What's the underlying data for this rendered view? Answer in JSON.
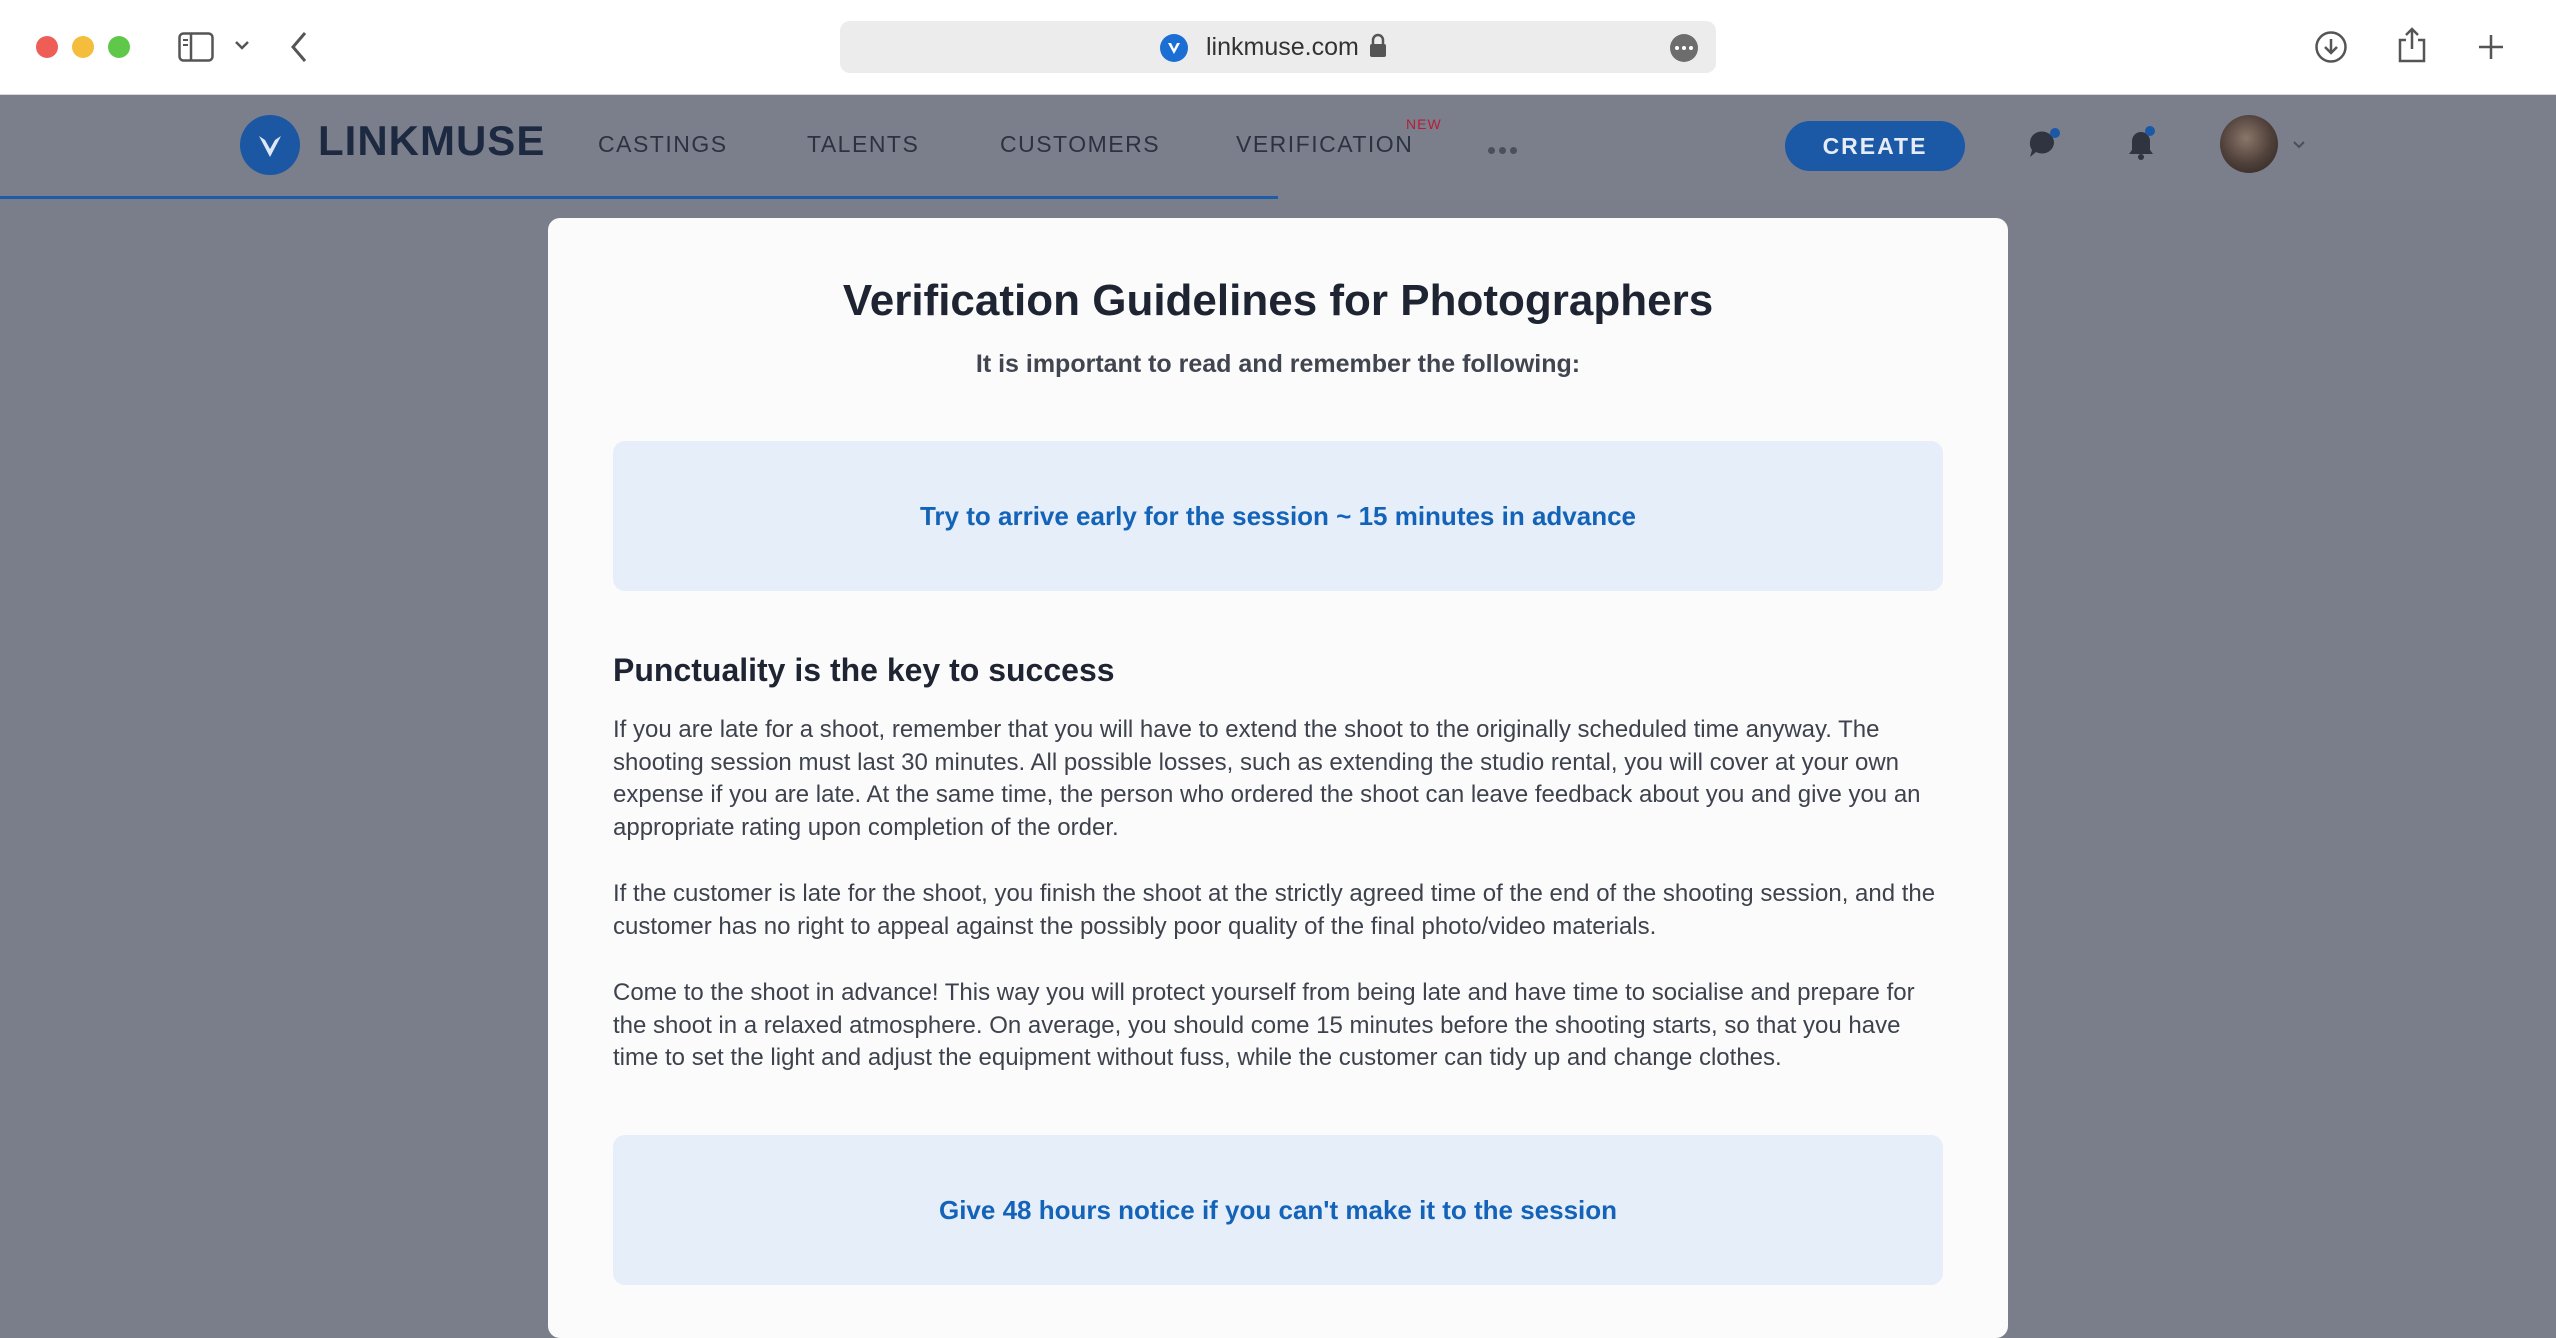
{
  "browser": {
    "url": "linkmuse.com"
  },
  "app": {
    "brand": "LINKMUSE",
    "nav": [
      {
        "label": "CASTINGS"
      },
      {
        "label": "TALENTS"
      },
      {
        "label": "CUSTOMERS"
      },
      {
        "label": "VERIFICATION",
        "badge": "NEW"
      }
    ],
    "create_label": "CREATE",
    "accent_color": "#1b58a6",
    "badge_color": "#b51d3a"
  },
  "content": {
    "title": "Verification Guidelines for Photographers",
    "subtitle": "It is important to read and remember the following:",
    "callouts": [
      "Try to arrive early for the session ~ 15 minutes in advance",
      "Give 48 hours notice if you can't make it to the session"
    ],
    "section_heading": "Punctuality is the key to success",
    "paragraphs": [
      "If you are late for a shoot, remember that you will have to extend the shoot to the originally scheduled time anyway. The shooting session must last 30 minutes. All possible losses, such as extending the studio rental, you will cover at your own expense if you are late. At the same time, the person who ordered the shoot can leave feedback about you and give you an appropriate rating upon completion of the order.",
      "If the customer is late for the shoot, you finish the shoot at the strictly agreed time of the end of the shooting session, and the customer has no right to appeal against the possibly poor quality of the final photo/video materials.",
      "Come to the shoot in advance! This way you will protect yourself from being late and have time to socialise and prepare for the shoot in a relaxed atmosphere. On average, you should come 15 minutes before the shooting starts, so that you have time to set the light and adjust the equipment without fuss, while the customer can tidy up and change clothes."
    ]
  }
}
